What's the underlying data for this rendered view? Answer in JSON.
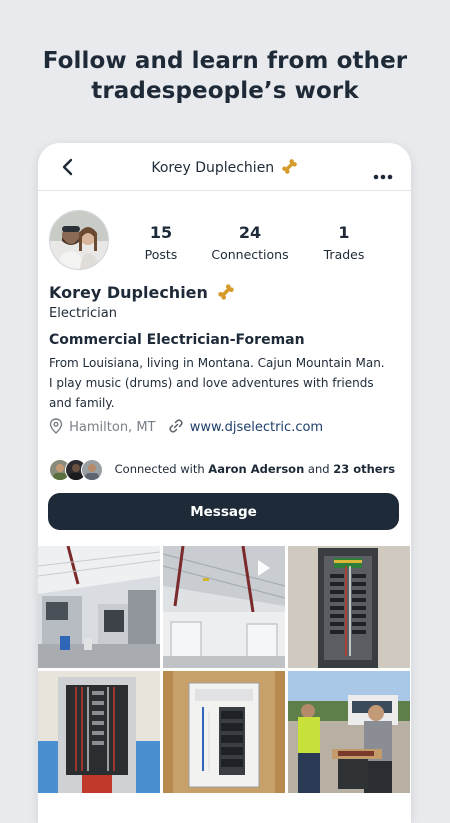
{
  "marketing": {
    "headline_line1": "Follow and learn from other",
    "headline_line2": "tradespeople’s work"
  },
  "topbar": {
    "title": "Korey Duplechien",
    "back_icon": "chevron-left-icon",
    "more_icon": "more-horizontal-icon",
    "badge_icon": "bone-icon"
  },
  "profile": {
    "name": "Korey Duplechien",
    "trade": "Electrician",
    "headline": "Commercial Electrician-Foreman",
    "bio": "From Louisiana, living in Montana. Cajun Mountain Man. I play music (drums) and love adventures with friends and family.",
    "location": "Hamilton, MT",
    "website": "www.djselectric.com",
    "stats": [
      {
        "value": "15",
        "label": "Posts"
      },
      {
        "value": "24",
        "label": "Connections"
      },
      {
        "value": "1",
        "label": "Trades"
      }
    ]
  },
  "connections": {
    "prefix": "Connected with",
    "name": "Aaron Aderson",
    "joiner": "and",
    "others": "23 others"
  },
  "actions": {
    "message_label": "Message"
  },
  "colors": {
    "navy": "#1e2a38",
    "badge_gold": "#d49a2a",
    "background": "#e8eaed",
    "link": "#1e3e6b"
  }
}
